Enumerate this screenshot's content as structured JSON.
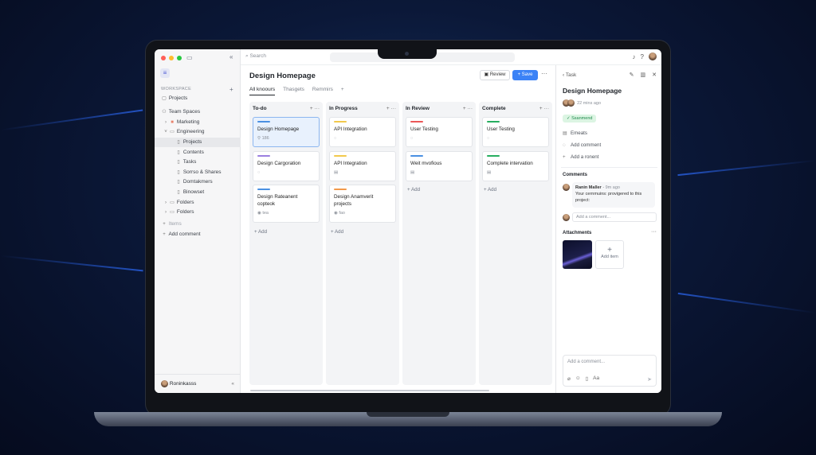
{
  "colors": {
    "accent": "#3b82f6",
    "status_green": "#1f8a4c",
    "bar_blue": "#4a90e2",
    "bar_purple": "#9b7fe0",
    "bar_yellow": "#f2c94c",
    "bar_orange": "#f2994a",
    "bar_red": "#eb5757",
    "bar_green": "#27ae60"
  },
  "topbar": {
    "search_placeholder": "Search"
  },
  "sidebar": {
    "workspace_label": "WORKSPACE",
    "projects": "Projects",
    "team_spaces": "Team Spaces",
    "marketing": "Marketing",
    "engineering": "Engineering",
    "eng_children": [
      "Projects",
      "Contents",
      "Tasks",
      "Sorrso & Shares",
      "Domtakmers",
      "Binowset"
    ],
    "folders": [
      "Folders",
      "Folders"
    ],
    "items": "Items",
    "add_comment": "Add comment",
    "user_name": "Roninkasss"
  },
  "main": {
    "title": "Design Homepage",
    "review_label": "Review",
    "save_label": "Save",
    "tabs": [
      "All knoours",
      "Thasgets",
      "Remmirs"
    ]
  },
  "board": {
    "add_label": "Add",
    "columns": [
      {
        "title": "To-do",
        "cards": [
          {
            "title": "Design Homepage",
            "meta": "186"
          },
          {
            "title": "Design Cargoration",
            "meta": ""
          },
          {
            "title": "Design Rateanent copteok",
            "meta": "tea"
          }
        ]
      },
      {
        "title": "In Progress",
        "cards": [
          {
            "title": "API Integration",
            "meta": ""
          },
          {
            "title": "API Integration",
            "meta": ""
          },
          {
            "title": "Design Anamverit projects",
            "meta": "fao"
          }
        ]
      },
      {
        "title": "In Review",
        "cards": [
          {
            "title": "User Testing",
            "meta": ""
          },
          {
            "title": "Weit mvofious",
            "meta": ""
          }
        ]
      },
      {
        "title": "Complete",
        "cards": [
          {
            "title": "User Testing",
            "meta": ""
          },
          {
            "title": "Complete intervation",
            "meta": ""
          }
        ]
      }
    ]
  },
  "panel": {
    "header": "Task",
    "title": "Design Homepage",
    "time": "22 mins ago",
    "status": "Ssanmend",
    "rows": [
      "Emeats",
      "Add comment",
      "Add a ronent"
    ],
    "comments_label": "Comments",
    "comment_author": "Ranin Maller",
    "comment_time": "9m ago",
    "comment_text": "Your cernmuins: provigered to this project:",
    "add_comment_placeholder": "Add a comment...",
    "attachments_label": "Attachments",
    "add_item": "Add item",
    "composer_placeholder": "Add a comment...",
    "composer_text_tool": "Aa"
  }
}
